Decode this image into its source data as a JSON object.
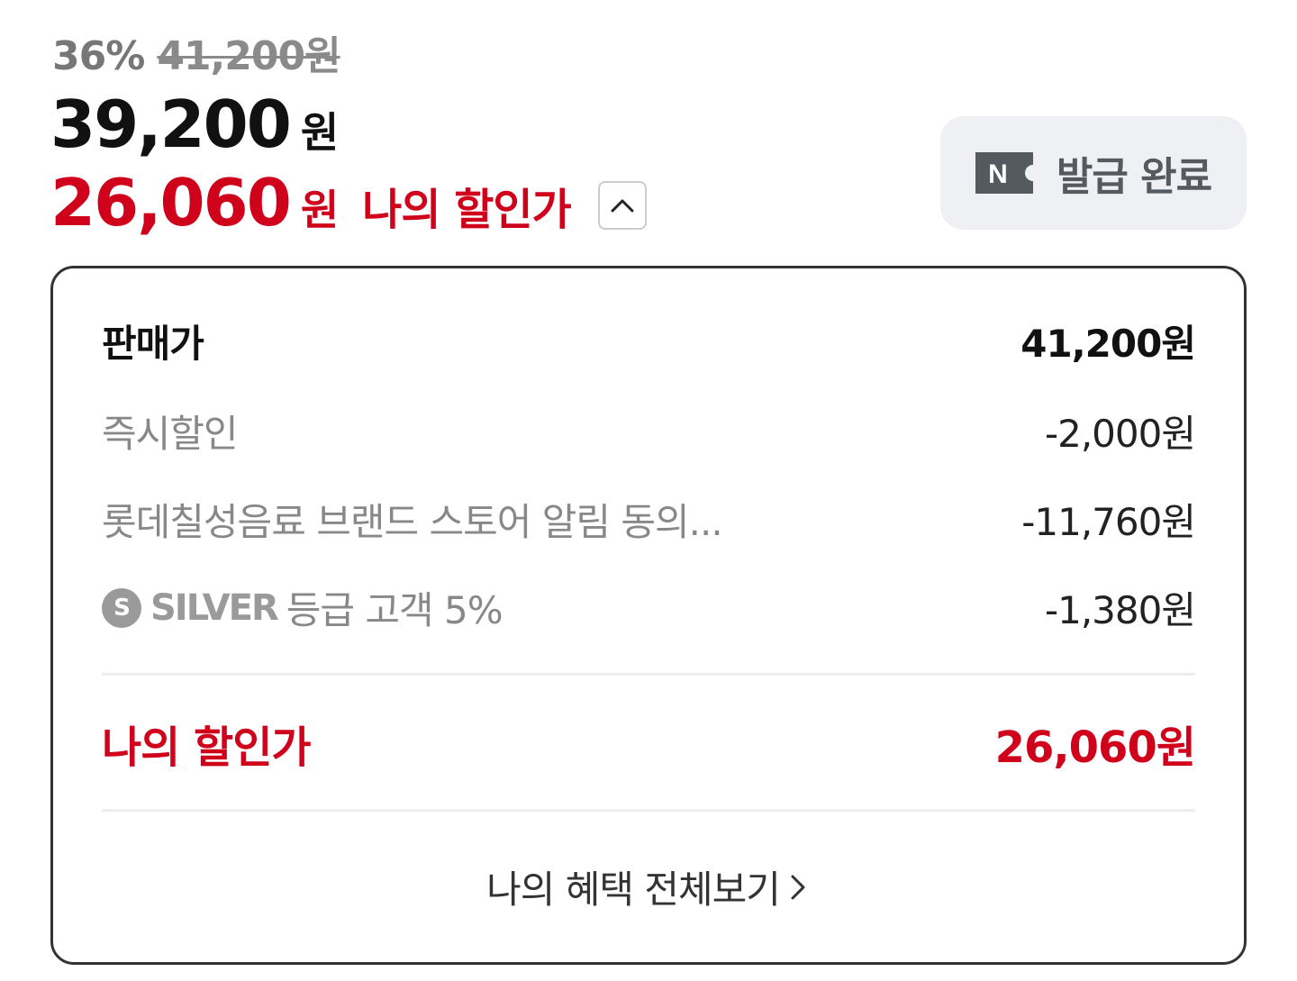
{
  "header": {
    "discount_rate": "36%",
    "original_price": "41,200원",
    "sale_price": "39,200",
    "sale_unit": "원",
    "my_price": "26,060",
    "my_unit": "원",
    "my_label": "나의 할인가",
    "toggle_icon": "chevron-up-icon"
  },
  "coupon": {
    "icon": "naver-coupon-icon",
    "icon_letter": "N",
    "label": "발급 완료"
  },
  "breakdown": {
    "rows": [
      {
        "label": "판매가",
        "value": "41,200원"
      },
      {
        "label": "즉시할인",
        "value": "-2,000원"
      },
      {
        "label": "롯데칠성음료 브랜드 스토어 알림 동의...",
        "value": "-11,760원"
      }
    ],
    "grade": {
      "badge": "S",
      "name": "SILVER",
      "label": "등급 고객 5%",
      "value": "-1,380원"
    },
    "total": {
      "label": "나의 할인가",
      "value": "26,060원"
    },
    "benefits_link": "나의 혜택 전체보기",
    "benefits_icon": "chevron-right-icon"
  },
  "colors": {
    "accent_red": "#d0021b",
    "muted_text": "#888888",
    "coupon_bg": "#eef0f3"
  }
}
